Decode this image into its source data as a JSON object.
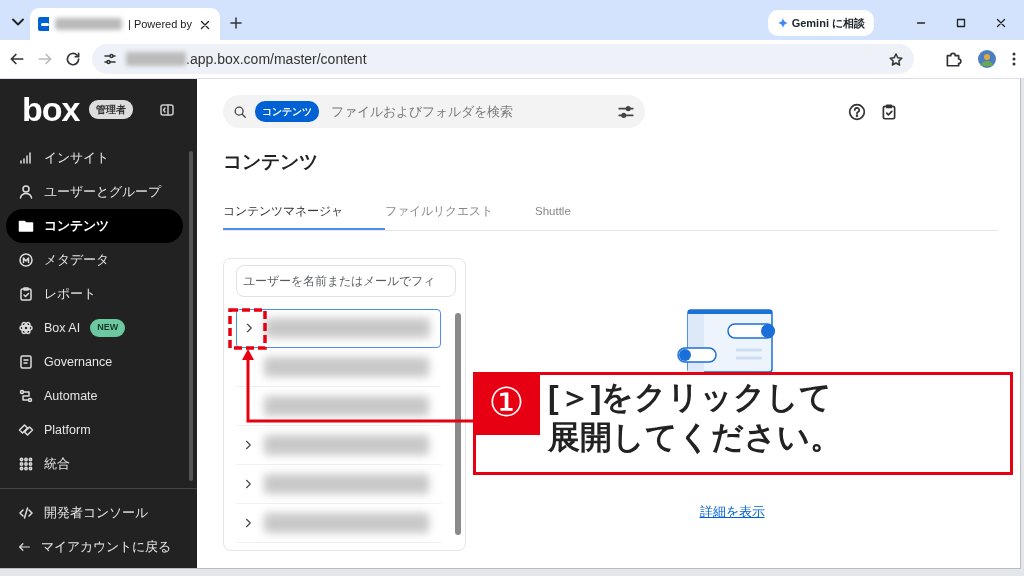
{
  "browser": {
    "tab_title": "| Powered by",
    "gemini_button": "Gemini に相談",
    "url": ".app.box.com/master/content",
    "forward_disabled": true
  },
  "sidebar": {
    "logo": "box",
    "role_badge": "管理者",
    "items": [
      {
        "label": "インサイト",
        "selected": false
      },
      {
        "label": "ユーザーとグループ",
        "selected": false
      },
      {
        "label": "コンテンツ",
        "selected": true
      },
      {
        "label": "メタデータ",
        "selected": false
      },
      {
        "label": "レポート",
        "selected": false
      },
      {
        "label": "Box AI",
        "selected": false,
        "badge": "NEW"
      },
      {
        "label": "Governance",
        "selected": false
      },
      {
        "label": "Automate",
        "selected": false
      },
      {
        "label": "Platform",
        "selected": false
      },
      {
        "label": "統合",
        "selected": false
      }
    ],
    "footer_items": [
      {
        "label": "開発者コンソール"
      },
      {
        "label": "マイアカウントに戻る"
      }
    ]
  },
  "search": {
    "scope_chip": "コンテンツ",
    "placeholder": "ファイルおよびフォルダを検索"
  },
  "page_title": "コンテンツ",
  "tabs": [
    {
      "label": "コンテンツマネージャ",
      "selected": true
    },
    {
      "label": "ファイルリクエスト",
      "selected": false
    },
    {
      "label": "Shuttle",
      "selected": false
    }
  ],
  "user_panel": {
    "filter_placeholder": "ユーザーを名前またはメールでフィ",
    "rows": [
      {
        "expandable": true,
        "selected": true
      },
      {
        "expandable": false,
        "selected": false
      },
      {
        "expandable": false,
        "selected": false
      },
      {
        "expandable": true,
        "selected": false
      },
      {
        "expandable": true,
        "selected": false
      },
      {
        "expandable": true,
        "selected": false
      }
    ]
  },
  "empty_state": {
    "link": "詳細を表示"
  },
  "callout": {
    "number": "①",
    "lines": [
      "[＞]をクリックして",
      "展開してください。"
    ]
  }
}
